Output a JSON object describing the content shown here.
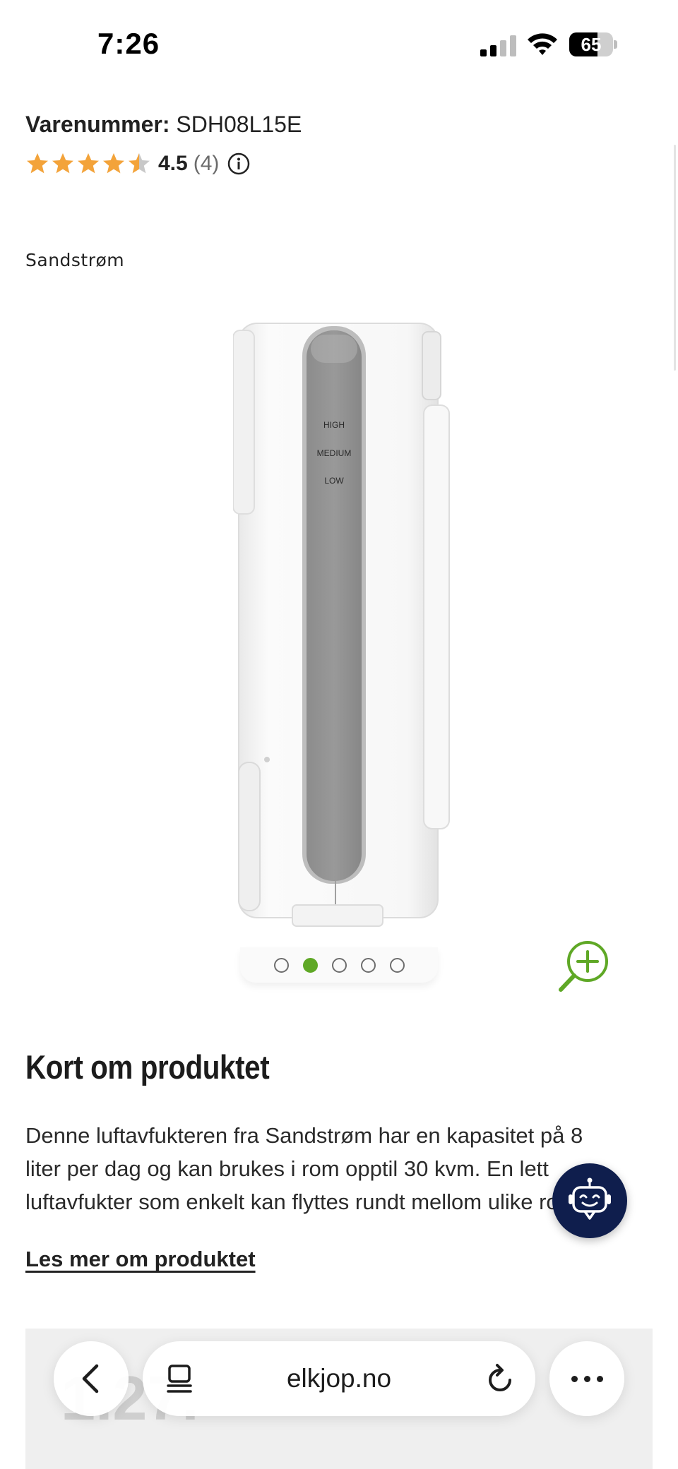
{
  "status_bar": {
    "time": "7:26",
    "battery_level": "65",
    "battery_fraction": 0.65
  },
  "product": {
    "sku_label": "Varenummer:",
    "sku_value": "SDH08L15E",
    "rating_value": "4.5",
    "rating_count": "(4)",
    "rating_stars": 4.5,
    "brand": "Sandstrøm",
    "image_labels": [
      "HIGH",
      "MEDIUM",
      "LOW"
    ]
  },
  "carousel": {
    "total": 5,
    "active_index": 1
  },
  "about": {
    "title": "Kort om produktet",
    "description_lines": [
      "Denne luftavfukteren fra Sandstrøm har en kapasitet på 8",
      "liter per dag og kan brukes i rom opptil 30 kvm. En lett",
      "luftavfukter som enkelt kan flyttes rundt mellom ulike rom."
    ],
    "read_more": "Les mer om produktet"
  },
  "behind_text": "1.27.",
  "browser": {
    "url": "elkjop.no"
  },
  "colors": {
    "accent_green": "#5fa826",
    "star": "#f3a33a",
    "chat_bg": "#0f1e4d"
  },
  "icons": [
    "signal-icon",
    "wifi-icon",
    "battery-icon",
    "star-icon",
    "info-icon",
    "zoom-in-icon",
    "chatbot-icon",
    "back-chevron-icon",
    "tabs-icon",
    "reload-icon",
    "more-icon"
  ]
}
